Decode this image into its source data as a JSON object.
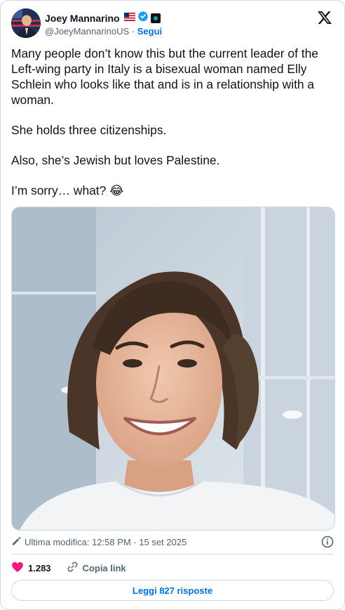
{
  "author": {
    "name": "Joey Mannarino",
    "handle": "@JoeyMannarinoUS",
    "separator": "·",
    "follow_label": "Segui",
    "badges": [
      "us-flag-icon",
      "verified-icon",
      "affiliate-icon"
    ]
  },
  "tweet": {
    "paragraphs": [
      "Many people don’t know this but the current leader of the Left-wing party in Italy is a bisexual woman named Elly Schlein who looks like that and is in a relationship with a woman.",
      "She holds three citizenships.",
      "Also, she’s Jewish but loves Palestine.",
      "I’m sorry… what? 😂"
    ]
  },
  "meta": {
    "edited_label": "Ultima modifica: 12:58 PM · 15 set 2025"
  },
  "actions": {
    "likes": "1.283",
    "copy_link_label": "Copia link",
    "replies_label": "Leggi 827 risposte"
  },
  "colors": {
    "link_blue": "#006fd6",
    "verified_blue": "#1d9bf0",
    "heart_pink": "#f91880",
    "border": "#cfd9de",
    "secondary_text": "#536471"
  }
}
